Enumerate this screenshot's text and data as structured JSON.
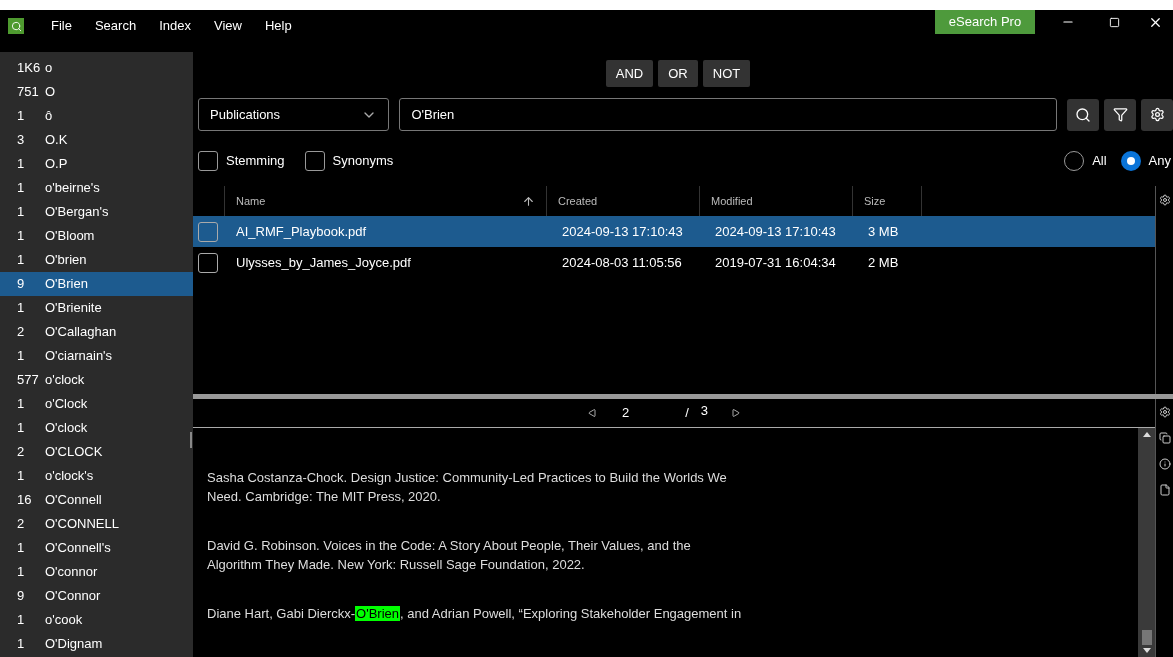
{
  "menu": [
    "File",
    "Search",
    "Index",
    "View",
    "Help"
  ],
  "title_badge": "eSearch Pro",
  "terms": [
    {
      "count": "1K6",
      "word": "o",
      "selected": false
    },
    {
      "count": "751",
      "word": "O",
      "selected": false
    },
    {
      "count": "1",
      "word": "ô",
      "selected": false
    },
    {
      "count": "3",
      "word": "O.K",
      "selected": false
    },
    {
      "count": "1",
      "word": "O.P",
      "selected": false
    },
    {
      "count": "1",
      "word": "o'beirne's",
      "selected": false
    },
    {
      "count": "1",
      "word": "O'Bergan's",
      "selected": false
    },
    {
      "count": "1",
      "word": "O'Bloom",
      "selected": false
    },
    {
      "count": "1",
      "word": "O'brien",
      "selected": false
    },
    {
      "count": "9",
      "word": "O'Brien",
      "selected": true
    },
    {
      "count": "1",
      "word": "O'Brienite",
      "selected": false
    },
    {
      "count": "2",
      "word": "O'Callaghan",
      "selected": false
    },
    {
      "count": "1",
      "word": "O'ciarnain's",
      "selected": false
    },
    {
      "count": "577",
      "word": "o'clock",
      "selected": false
    },
    {
      "count": "1",
      "word": "o'Clock",
      "selected": false
    },
    {
      "count": "1",
      "word": "O'clock",
      "selected": false
    },
    {
      "count": "2",
      "word": "O'CLOCK",
      "selected": false
    },
    {
      "count": "1",
      "word": "o'clock's",
      "selected": false
    },
    {
      "count": "16",
      "word": "O'Connell",
      "selected": false
    },
    {
      "count": "2",
      "word": "O'CONNELL",
      "selected": false
    },
    {
      "count": "1",
      "word": "O'Connell's",
      "selected": false
    },
    {
      "count": "1",
      "word": "O'connor",
      "selected": false
    },
    {
      "count": "9",
      "word": "O'Connor",
      "selected": false
    },
    {
      "count": "1",
      "word": "o'cook",
      "selected": false
    },
    {
      "count": "1",
      "word": "O'Dignam",
      "selected": false
    }
  ],
  "operators": [
    "AND",
    "OR",
    "NOT"
  ],
  "scope": "Publications",
  "query": "O'Brien",
  "options": [
    {
      "label": "Stemming",
      "checked": false
    },
    {
      "label": "Synonyms",
      "checked": false
    }
  ],
  "match_modes": [
    {
      "label": "All",
      "selected": false
    },
    {
      "label": "Any",
      "selected": true
    }
  ],
  "table": {
    "columns": [
      "Name",
      "Created",
      "Modified",
      "Size"
    ],
    "rows": [
      {
        "selected": true,
        "checked": false,
        "cells": [
          "AI_RMF_Playbook.pdf",
          "2024-09-13 17:10:43",
          "2024-09-13 17:10:43",
          "3 MB"
        ]
      },
      {
        "selected": false,
        "checked": false,
        "cells": [
          "Ulysses_by_James_Joyce.pdf",
          "2024-08-03 11:05:56",
          "2019-07-31 16:04:34",
          "2 MB"
        ]
      }
    ]
  },
  "pager": {
    "page": "2",
    "separator": "/",
    "total": "3"
  },
  "preview": [
    [
      {
        "text": "Sasha Costanza-Chock. Design Justice: Community-Led Practices to Build the Worlds We Need. Cambridge: The MIT Press, 2020.",
        "highlight": false
      }
    ],
    [
      {
        "text": "David G. Robinson. Voices in the Code: A Story About People, Their Values, and the Algorithm They Made. New York: Russell Sage Foundation, 2022.",
        "highlight": false
      }
    ],
    [
      {
        "text": "Diane Hart, Gabi Dierckx-",
        "highlight": false
      },
      {
        "text": "O'Brien",
        "highlight": true
      },
      {
        "text": ", and Adrian Powell, “Exploring Stakeholder Engagement in",
        "highlight": false
      }
    ]
  ]
}
